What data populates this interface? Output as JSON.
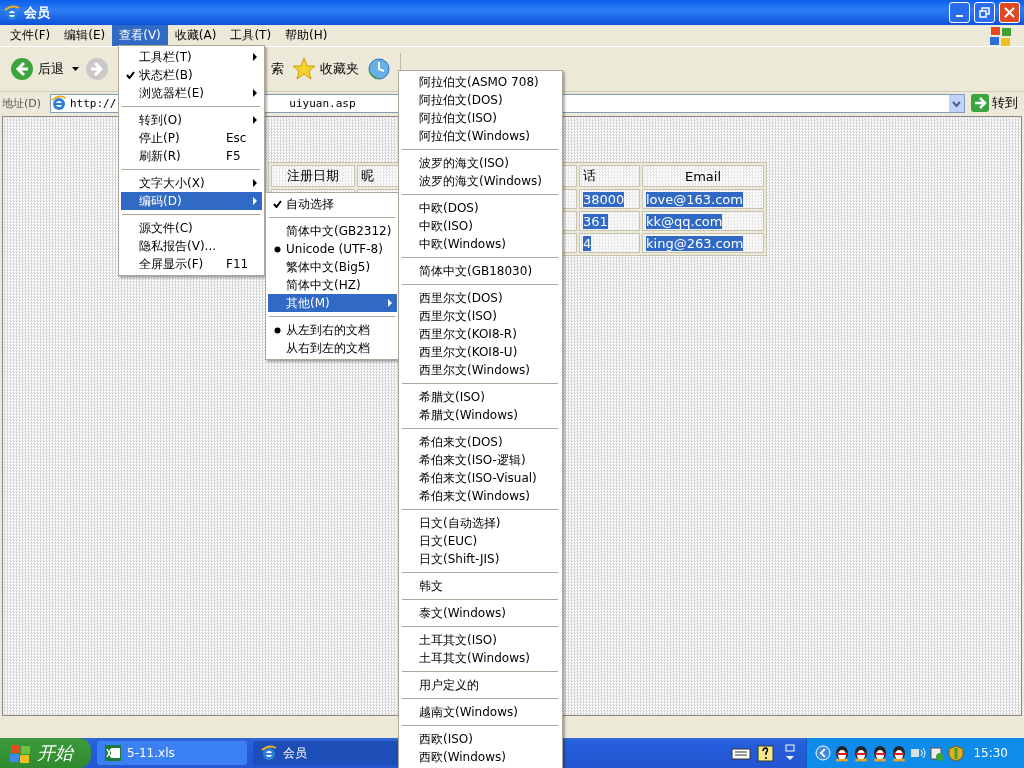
{
  "window": {
    "title": "会员"
  },
  "menu_bar": [
    {
      "label": "文件(F)",
      "selected": false
    },
    {
      "label": "编辑(E)",
      "selected": false
    },
    {
      "label": "查看(V)",
      "selected": true
    },
    {
      "label": "收藏(A)",
      "selected": false
    },
    {
      "label": "工具(T)",
      "selected": false
    },
    {
      "label": "帮助(H)",
      "selected": false
    }
  ],
  "toolbar": {
    "back": "后退",
    "search": "索",
    "favorites": "收藏夹"
  },
  "address_bar": {
    "label": "地址(D)",
    "url_start": "http://",
    "url_end": "uiyuan.asp",
    "go": "转到"
  },
  "table": {
    "columns": [
      "注册日期",
      "昵",
      "",
      "话",
      "Email"
    ],
    "rows": [
      {
        "phone": "38000",
        "email": "love@163.com"
      },
      {
        "phone": "361",
        "email": "kk@qq.com"
      },
      {
        "phone": "4",
        "email": "king@263.com"
      }
    ]
  },
  "view_menu": {
    "items": [
      {
        "kind": "submenu",
        "label": "工具栏(T)",
        "selected": false
      },
      {
        "kind": "check",
        "label": "状态栏(B)",
        "checked": true,
        "selected": false
      },
      {
        "kind": "submenu",
        "label": "浏览器栏(E)",
        "selected": false
      },
      {
        "kind": "separator"
      },
      {
        "kind": "submenu",
        "label": "转到(O)",
        "selected": false
      },
      {
        "kind": "plain",
        "label": "停止(P)",
        "shortcut": "Esc",
        "selected": false
      },
      {
        "kind": "plain",
        "label": "刷新(R)",
        "shortcut": "F5",
        "selected": false
      },
      {
        "kind": "separator"
      },
      {
        "kind": "submenu",
        "label": "文字大小(X)",
        "selected": false
      },
      {
        "kind": "submenu",
        "label": "编码(D)",
        "selected": true
      },
      {
        "kind": "separator"
      },
      {
        "kind": "plain",
        "label": "源文件(C)",
        "selected": false
      },
      {
        "kind": "plain",
        "label": "隐私报告(V)...",
        "selected": false
      },
      {
        "kind": "plain",
        "label": "全屏显示(F)",
        "shortcut": "F11",
        "selected": false
      }
    ]
  },
  "encoding_menu": {
    "items": [
      {
        "kind": "check",
        "label": "自动选择",
        "checked": true,
        "selected": false
      },
      {
        "kind": "separator"
      },
      {
        "kind": "radio",
        "label": "简体中文(GB2312)",
        "checked": false,
        "selected": false
      },
      {
        "kind": "radio",
        "label": "Unicode (UTF-8)",
        "checked": true,
        "selected": false
      },
      {
        "kind": "radio",
        "label": "繁体中文(Big5)",
        "checked": false,
        "selected": false
      },
      {
        "kind": "radio",
        "label": "简体中文(HZ)",
        "checked": false,
        "selected": false
      },
      {
        "kind": "submenu",
        "label": "其他(M)",
        "selected": true
      },
      {
        "kind": "separator"
      },
      {
        "kind": "radio",
        "label": "从左到右的文档",
        "checked": true,
        "selected": false
      },
      {
        "kind": "radio",
        "label": "从右到左的文档",
        "checked": false,
        "selected": false
      }
    ]
  },
  "other_menu": {
    "items": [
      {
        "kind": "plain",
        "label": "阿拉伯文(ASMO 708)",
        "selected": false
      },
      {
        "kind": "plain",
        "label": "阿拉伯文(DOS)",
        "selected": false
      },
      {
        "kind": "plain",
        "label": "阿拉伯文(ISO)",
        "selected": false
      },
      {
        "kind": "plain",
        "label": "阿拉伯文(Windows)",
        "selected": false
      },
      {
        "kind": "separator"
      },
      {
        "kind": "plain",
        "label": "波罗的海文(ISO)",
        "selected": false
      },
      {
        "kind": "plain",
        "label": "波罗的海文(Windows)",
        "selected": false
      },
      {
        "kind": "separator"
      },
      {
        "kind": "plain",
        "label": "中欧(DOS)",
        "selected": false
      },
      {
        "kind": "plain",
        "label": "中欧(ISO)",
        "selected": false
      },
      {
        "kind": "plain",
        "label": "中欧(Windows)",
        "selected": false
      },
      {
        "kind": "separator"
      },
      {
        "kind": "plain",
        "label": "简体中文(GB18030)",
        "selected": false
      },
      {
        "kind": "separator"
      },
      {
        "kind": "plain",
        "label": "西里尔文(DOS)",
        "selected": false
      },
      {
        "kind": "plain",
        "label": "西里尔文(ISO)",
        "selected": false
      },
      {
        "kind": "plain",
        "label": "西里尔文(KOI8-R)",
        "selected": false
      },
      {
        "kind": "plain",
        "label": "西里尔文(KOI8-U)",
        "selected": false
      },
      {
        "kind": "plain",
        "label": "西里尔文(Windows)",
        "selected": false
      },
      {
        "kind": "separator"
      },
      {
        "kind": "plain",
        "label": "希腊文(ISO)",
        "selected": false
      },
      {
        "kind": "plain",
        "label": "希腊文(Windows)",
        "selected": false
      },
      {
        "kind": "separator"
      },
      {
        "kind": "plain",
        "label": "希伯来文(DOS)",
        "selected": false
      },
      {
        "kind": "plain",
        "label": "希伯来文(ISO-逻辑)",
        "selected": false
      },
      {
        "kind": "plain",
        "label": "希伯来文(ISO-Visual)",
        "selected": false
      },
      {
        "kind": "plain",
        "label": "希伯来文(Windows)",
        "selected": false
      },
      {
        "kind": "separator"
      },
      {
        "kind": "plain",
        "label": "日文(自动选择)",
        "selected": false
      },
      {
        "kind": "plain",
        "label": "日文(EUC)",
        "selected": false
      },
      {
        "kind": "plain",
        "label": "日文(Shift-JIS)",
        "selected": false
      },
      {
        "kind": "separator"
      },
      {
        "kind": "plain",
        "label": "韩文",
        "selected": false
      },
      {
        "kind": "separator"
      },
      {
        "kind": "plain",
        "label": "泰文(Windows)",
        "selected": false
      },
      {
        "kind": "separator"
      },
      {
        "kind": "plain",
        "label": "土耳其文(ISO)",
        "selected": false
      },
      {
        "kind": "plain",
        "label": "土耳其文(Windows)",
        "selected": false
      },
      {
        "kind": "separator"
      },
      {
        "kind": "plain",
        "label": "用户定义的",
        "selected": false
      },
      {
        "kind": "separator"
      },
      {
        "kind": "plain",
        "label": "越南文(Windows)",
        "selected": false
      },
      {
        "kind": "separator"
      },
      {
        "kind": "plain",
        "label": "西欧(ISO)",
        "selected": false
      },
      {
        "kind": "plain",
        "label": "西欧(Windows)",
        "selected": false
      }
    ]
  },
  "taskbar": {
    "start": "开始",
    "tasks": [
      {
        "label": "5-11.xls",
        "selected": false
      },
      {
        "label": "会员",
        "selected": true
      }
    ],
    "clock": "15:30"
  }
}
